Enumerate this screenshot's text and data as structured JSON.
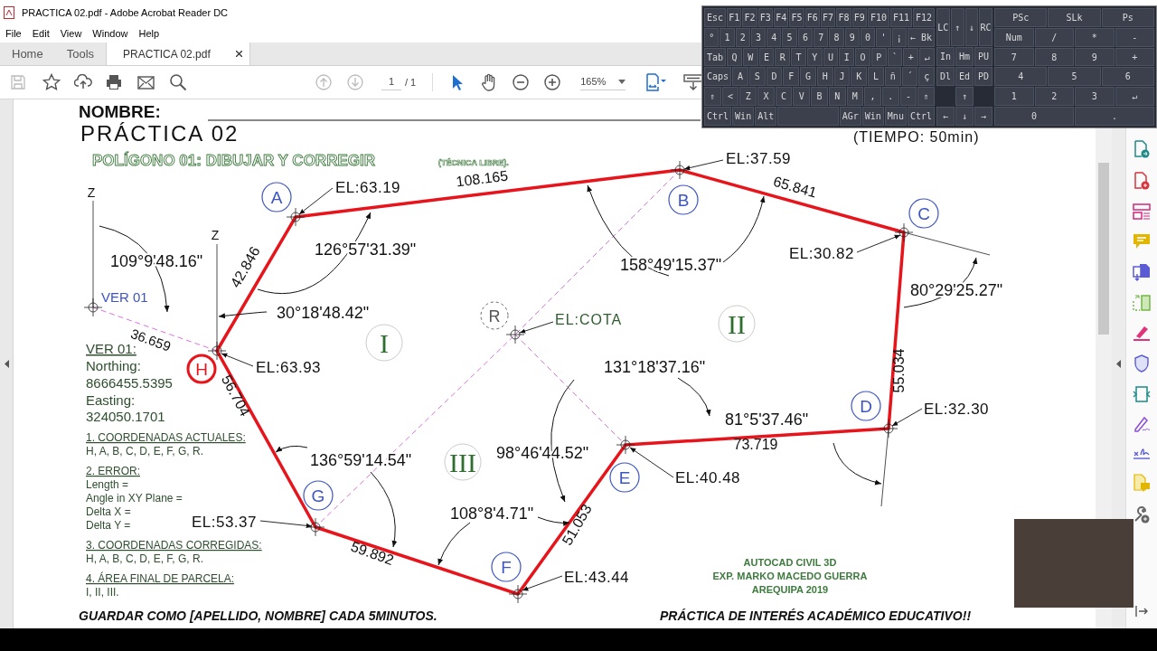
{
  "window": {
    "title": "PRACTICA 02.pdf - Adobe Acrobat Reader DC"
  },
  "menu": [
    "File",
    "Edit",
    "View",
    "Window",
    "Help"
  ],
  "tabs": [
    {
      "label": "Home",
      "selected": false
    },
    {
      "label": "Tools",
      "selected": false
    },
    {
      "label": "PRACTICA 02.pdf",
      "selected": true
    }
  ],
  "toolbar": {
    "page": "1",
    "page_total": "/ 1",
    "zoom": "165%"
  },
  "document": {
    "name_label": "NOMBRE:",
    "title": "PRÁCTICA 02",
    "subtitle": "POLÍGONO 01: DIBUJAR Y CORREGIR",
    "subtitle_note": "(TÉCNICA LIBRE).",
    "time": "(TIEMPO: 50min)",
    "vertices": [
      {
        "label": "A",
        "elevation": "EL:63.19",
        "highlighted": false
      },
      {
        "label": "B",
        "elevation": "EL:37.59",
        "highlighted": false
      },
      {
        "label": "C",
        "elevation": "EL:30.82",
        "highlighted": false
      },
      {
        "label": "H",
        "elevation": "EL:63.93",
        "highlighted": true
      },
      {
        "label": "D",
        "elevation": "EL:32.30",
        "highlighted": false
      },
      {
        "label": "E",
        "elevation": "EL:40.48",
        "highlighted": false
      },
      {
        "label": "G",
        "elevation": "EL:53.37",
        "highlighted": false
      },
      {
        "label": "F",
        "elevation": "EL:43.44",
        "highlighted": false
      }
    ],
    "edge_lengths": [
      "108.165",
      "65.841",
      "42.846",
      "55.034",
      "56.704",
      "73.719",
      "51.053",
      "59.892"
    ],
    "angles": [
      "126°57'31.39\"",
      "109°9'48.16\"",
      "158°49'15.37\"",
      "80°29'25.27\"",
      "30°18'48.42\"",
      "131°18'37.16\"",
      "81°5'37.46\"",
      "98°46'44.52\"",
      "136°59'14.54\"",
      "108°8'4.71\""
    ],
    "reference_point": {
      "label": "R",
      "elevation": "EL:COTA"
    },
    "zones": [
      "II",
      "I",
      "III"
    ],
    "z_labels": [
      "Z",
      "Z"
    ],
    "control_point": {
      "label": "VER 01",
      "distance": "36.659"
    },
    "control_info": [
      "VER 01:",
      "Northing:",
      "8666455.5395",
      "Easting:",
      "324050.1701"
    ],
    "notes": [
      {
        "heading": "1. COORDENADAS ACTUALES:",
        "lines": [
          "H, A, B, C, D, E, F, G, R."
        ]
      },
      {
        "heading": "2. ERROR:",
        "lines": [
          "Length =",
          "Angle in XY Plane =",
          "Delta X =",
          "Delta Y ="
        ]
      },
      {
        "heading": "3. COORDENADAS CORREGIDAS:",
        "lines": [
          "H, A, B, C, D, E, F, G, R."
        ]
      },
      {
        "heading": "4. ÁREA FINAL DE PARCELA:",
        "lines": [
          "I, II, III."
        ]
      }
    ],
    "credits": [
      "AUTOCAD CIVIL 3D",
      "EXP. MARKO MACEDO GUERRA",
      "AREQUIPA 2019"
    ],
    "footer_left": "GUARDAR COMO [APELLIDO, NOMBRE] CADA 5MINUTOS.",
    "footer_right": "PRÁCTICA DE INTERÉS ACADÉMICO EDUCATIVO!!"
  },
  "keyboard": {
    "main_rows": [
      [
        "Esc",
        "F1",
        "F2",
        "F3",
        "F4",
        "F5",
        "F6",
        "F7",
        "F8",
        "F9",
        "F10",
        "F11",
        "F12"
      ],
      [
        "°",
        "1",
        "2",
        "3",
        "4",
        "5",
        "6",
        "7",
        "8",
        "9",
        "0",
        "'",
        "¡",
        "← Bk"
      ],
      [
        "Tab",
        "Q",
        "W",
        "E",
        "R",
        "T",
        "Y",
        "U",
        "I",
        "O",
        "P",
        "`",
        "+",
        "↵"
      ],
      [
        "Caps",
        "A",
        "S",
        "D",
        "F",
        "G",
        "H",
        "J",
        "K",
        "L",
        "ñ",
        "´",
        "ç"
      ],
      [
        "⇑",
        "<",
        "Z",
        "X",
        "C",
        "V",
        "B",
        "N",
        "M",
        ",",
        ".",
        "-",
        "⇑"
      ]
    ],
    "bottom_left": [
      "Ctrl",
      "Win",
      "Alt"
    ],
    "bottom_right": [
      "AGr",
      "Win",
      "Mnu",
      "Ctrl"
    ],
    "nav_top": [
      "LC",
      "↑",
      "↓",
      "RC"
    ],
    "nav_mid": [
      "In",
      "Hm",
      "PU",
      "Dl",
      "Ed",
      "PD"
    ],
    "nav_arrows": [
      "↑",
      "←",
      "↓",
      "→"
    ],
    "numpad_rows": [
      [
        "PSc",
        "SLk",
        "Ps"
      ],
      [
        "Num",
        "/",
        "*",
        "-"
      ],
      [
        "7",
        "8",
        "9",
        "+"
      ],
      [
        "4",
        "5",
        "6"
      ],
      [
        "1",
        "2",
        "3",
        "↵"
      ],
      [
        "0",
        "."
      ]
    ]
  }
}
